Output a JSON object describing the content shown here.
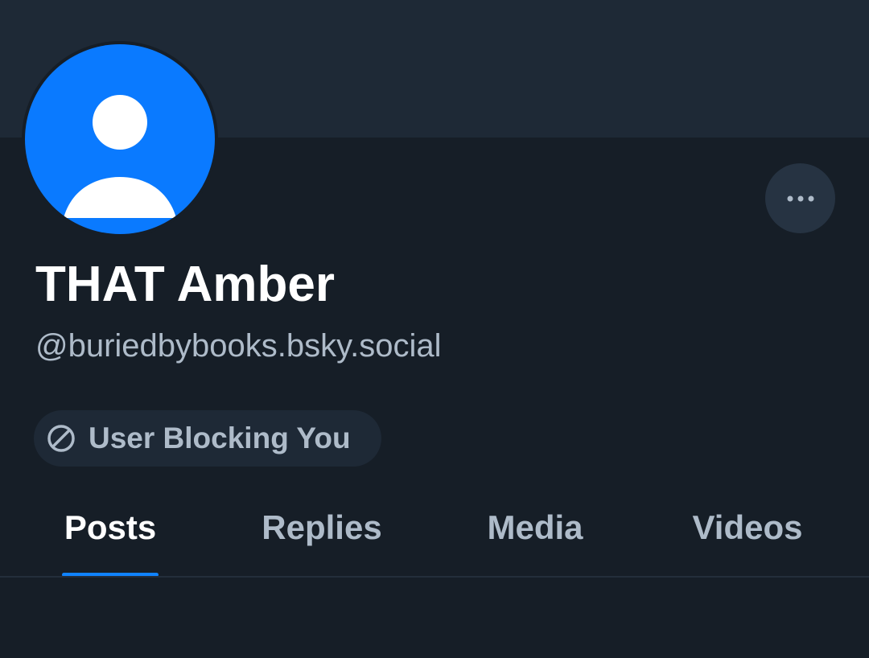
{
  "profile": {
    "display_name": "THAT Amber",
    "handle": "@buriedbybooks.bsky.social",
    "avatar_icon": "default-person-avatar-icon"
  },
  "status": {
    "label": "User Blocking You",
    "icon": "block-icon"
  },
  "actions": {
    "more_icon": "ellipsis-icon"
  },
  "tabs": [
    {
      "label": "Posts",
      "active": true
    },
    {
      "label": "Replies",
      "active": false
    },
    {
      "label": "Media",
      "active": false
    },
    {
      "label": "Videos",
      "active": false
    }
  ],
  "colors": {
    "background": "#161e27",
    "banner": "#1e2936",
    "avatar": "#0a7aff",
    "accent": "#1083fe",
    "muted_text": "#aebbc9"
  }
}
